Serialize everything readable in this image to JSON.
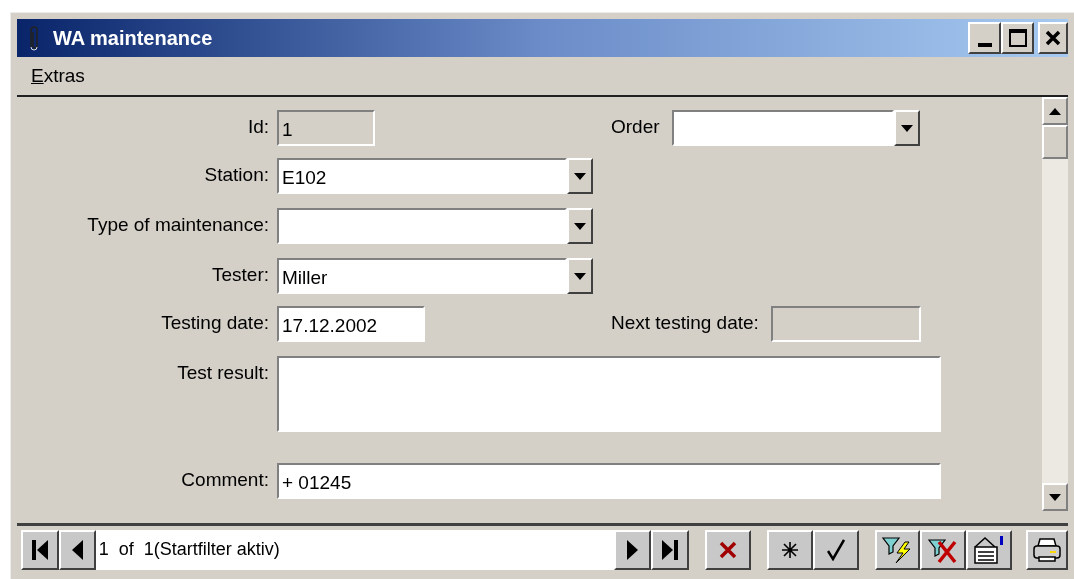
{
  "window": {
    "title": "WA maintenance"
  },
  "menu": [
    {
      "label": "Extras"
    }
  ],
  "form": {
    "rows": [
      {
        "fields": [
          {
            "label": "Id:",
            "value": "1",
            "kind": "readonly"
          },
          {
            "label": "Order",
            "kind": "combo"
          }
        ]
      },
      {
        "fields": [
          {
            "label": "Station:",
            "value": "E102",
            "kind": "combo"
          }
        ]
      },
      {
        "fields": [
          {
            "label": "Type of maintenance:",
            "kind": "combo"
          }
        ]
      },
      {
        "fields": [
          {
            "label": "Tester:",
            "value": "Miller",
            "kind": "combo"
          }
        ]
      },
      {
        "fields": [
          {
            "label": "Testing date:",
            "value": "17.12.2002",
            "kind": "text"
          },
          {
            "label": "Next testing date:",
            "kind": "readonly"
          }
        ]
      },
      {
        "fields": [
          {
            "label": "Test result:",
            "kind": "textarea"
          }
        ]
      },
      {
        "fields": [
          {
            "label": "Comment:",
            "value": "+ 01245",
            "kind": "text"
          }
        ]
      }
    ]
  },
  "record_navigator": {
    "text": "1  of  1(Startfilter aktiv)"
  }
}
